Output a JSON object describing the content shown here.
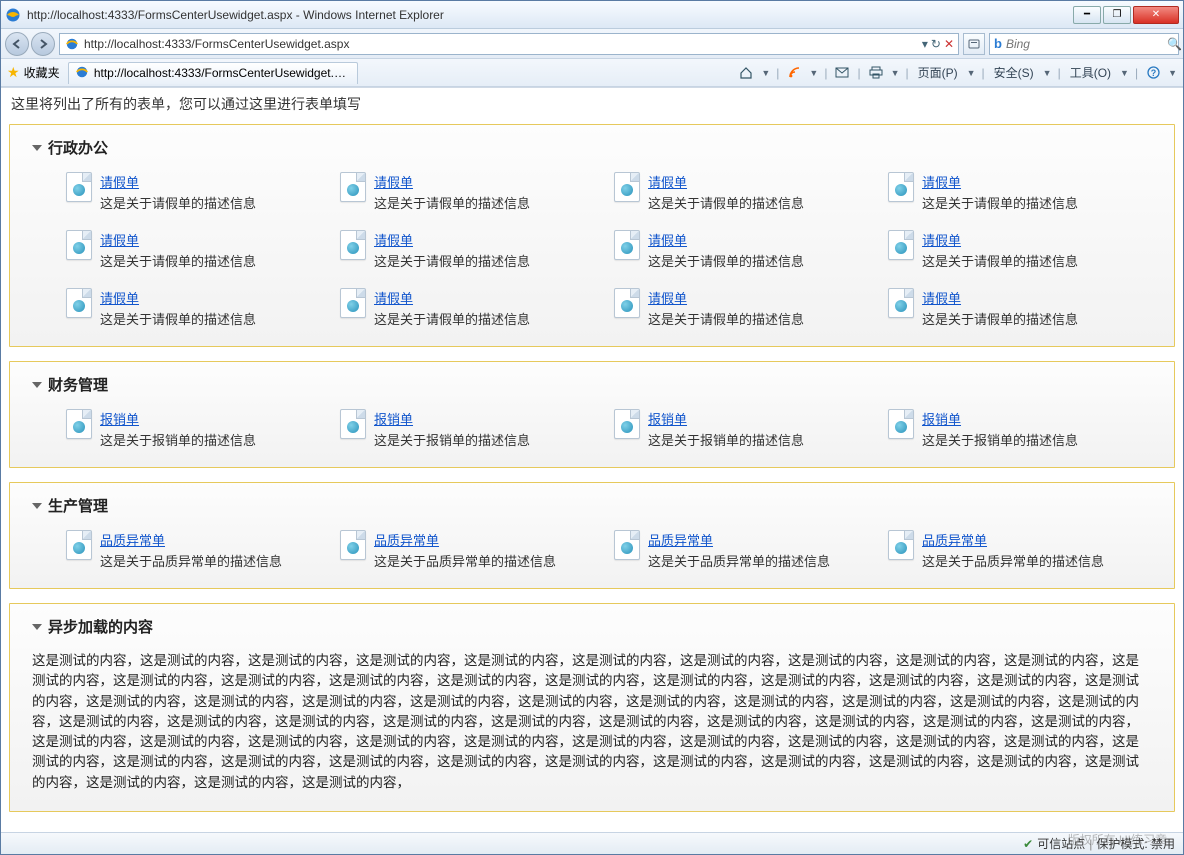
{
  "window": {
    "title": "http://localhost:4333/FormsCenterUsewidget.aspx - Windows Internet Explorer"
  },
  "address": {
    "url": "http://localhost:4333/FormsCenterUsewidget.aspx"
  },
  "search": {
    "placeholder": "Bing"
  },
  "favorites": {
    "label": "收藏夹",
    "tab_label": "http://localhost:4333/FormsCenterUsewidget.aspx"
  },
  "command_bar": {
    "page_menu": "页面(P)",
    "safety_menu": "安全(S)",
    "tools_menu": "工具(O)"
  },
  "page": {
    "intro": "这里将列出了所有的表单，您可以通过这里进行表单填写",
    "sections": [
      {
        "title": "行政办公",
        "items": [
          {
            "name": "请假单",
            "desc": "这是关于请假单的描述信息"
          },
          {
            "name": "请假单",
            "desc": "这是关于请假单的描述信息"
          },
          {
            "name": "请假单",
            "desc": "这是关于请假单的描述信息"
          },
          {
            "name": "请假单",
            "desc": "这是关于请假单的描述信息"
          },
          {
            "name": "请假单",
            "desc": "这是关于请假单的描述信息"
          },
          {
            "name": "请假单",
            "desc": "这是关于请假单的描述信息"
          },
          {
            "name": "请假单",
            "desc": "这是关于请假单的描述信息"
          },
          {
            "name": "请假单",
            "desc": "这是关于请假单的描述信息"
          },
          {
            "name": "请假单",
            "desc": "这是关于请假单的描述信息"
          },
          {
            "name": "请假单",
            "desc": "这是关于请假单的描述信息"
          },
          {
            "name": "请假单",
            "desc": "这是关于请假单的描述信息"
          },
          {
            "name": "请假单",
            "desc": "这是关于请假单的描述信息"
          }
        ]
      },
      {
        "title": "财务管理",
        "items": [
          {
            "name": "报销单",
            "desc": "这是关于报销单的描述信息"
          },
          {
            "name": "报销单",
            "desc": "这是关于报销单的描述信息"
          },
          {
            "name": "报销单",
            "desc": "这是关于报销单的描述信息"
          },
          {
            "name": "报销单",
            "desc": "这是关于报销单的描述信息"
          }
        ]
      },
      {
        "title": "生产管理",
        "items": [
          {
            "name": "品质异常单",
            "desc": "这是关于品质异常单的描述信息"
          },
          {
            "name": "品质异常单",
            "desc": "这是关于品质异常单的描述信息"
          },
          {
            "name": "品质异常单",
            "desc": "这是关于品质异常单的描述信息"
          },
          {
            "name": "品质异常单",
            "desc": "这是关于品质异常单的描述信息"
          }
        ]
      }
    ],
    "async": {
      "title": "异步加载的内容",
      "body": "这是测试的内容，这是测试的内容，这是测试的内容，这是测试的内容，这是测试的内容，这是测试的内容，这是测试的内容，这是测试的内容，这是测试的内容，这是测试的内容，这是测试的内容，这是测试的内容，这是测试的内容，这是测试的内容，这是测试的内容，这是测试的内容，这是测试的内容，这是测试的内容，这是测试的内容，这是测试的内容，这是测试的内容，这是测试的内容，这是测试的内容，这是测试的内容，这是测试的内容，这是测试的内容，这是测试的内容，这是测试的内容，这是测试的内容，这是测试的内容，这是测试的内容，这是测试的内容，这是测试的内容，这是测试的内容，这是测试的内容，这是测试的内容，这是测试的内容，这是测试的内容，这是测试的内容，这是测试的内容，这是测试的内容，这是测试的内容，这是测试的内容，这是测试的内容，这是测试的内容，这是测试的内容，这是测试的内容，这是测试的内容，这是测试的内容，这是测试的内容，这是测试的内容，这是测试的内容，这是测试的内容，这是测试的内容，这是测试的内容，这是测试的内容，这是测试的内容，这是测试的内容，这是测试的内容，这是测试的内容，这是测试的内容，这是测试的内容，这是测试的内容，这是测试的内容，这是测试的内容，"
    }
  },
  "status": {
    "trusted": "可信站点",
    "protected": "保护模式: 禁用"
  },
  "watermark": "版权所有 UI练习章"
}
